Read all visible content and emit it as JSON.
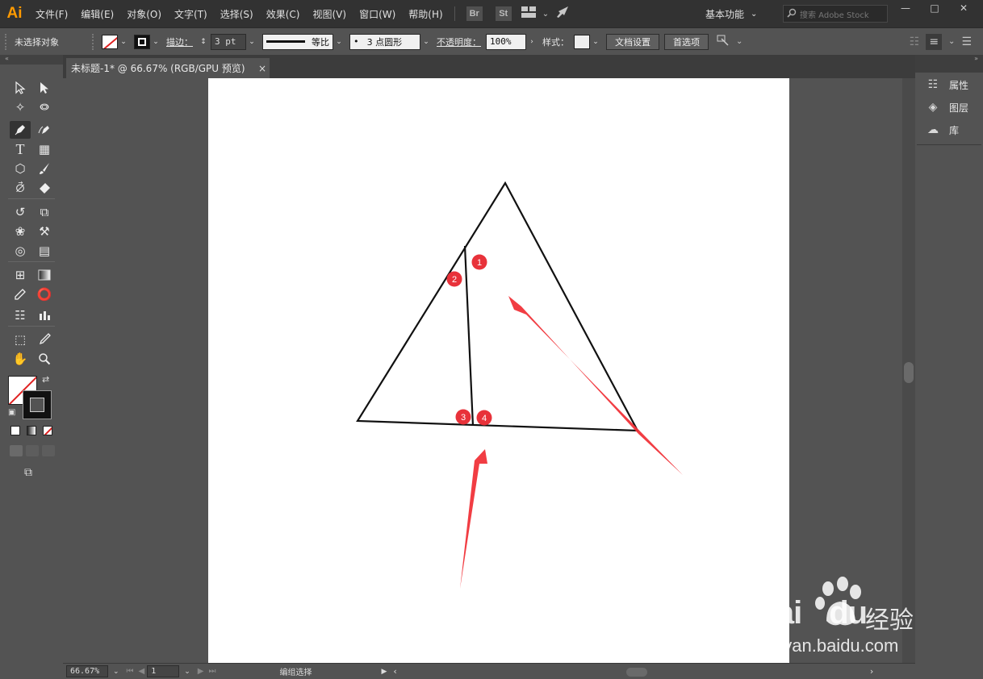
{
  "app": {
    "logo": "Ai"
  },
  "menu": {
    "items": [
      "文件(F)",
      "编辑(E)",
      "对象(O)",
      "文字(T)",
      "选择(S)",
      "效果(C)",
      "视图(V)",
      "窗口(W)",
      "帮助(H)"
    ],
    "bridge_label": "Br",
    "stock_label": "St",
    "workspace": "基本功能",
    "search_placeholder": "搜索 Adobe Stock"
  },
  "control_bar": {
    "selection_status": "未选择对象",
    "stroke_label": "描边：",
    "stroke_weight": "3 pt",
    "stroke_profile": "等比",
    "brush": "3 点圆形",
    "opacity_label": "不透明度：",
    "opacity_value": "100%",
    "style_label": "样式：",
    "doc_setup_button": "文档设置",
    "preferences_button": "首选项"
  },
  "document": {
    "tab_title": "未标题-1* @ 66.67% (RGB/GPU 预览)",
    "close": "×"
  },
  "right_panel": {
    "items": [
      {
        "label": "属性",
        "icon": "properties-icon"
      },
      {
        "label": "图层",
        "icon": "layers-icon"
      },
      {
        "label": "库",
        "icon": "libraries-icon"
      }
    ]
  },
  "status_bar": {
    "zoom": "66.67%",
    "artboard_number": "1",
    "tool_status": "编组选择"
  },
  "annotations": {
    "markers": [
      "1",
      "2",
      "3",
      "4"
    ]
  },
  "watermark": {
    "brand": "Bai",
    "brand_suffix": "du",
    "product": "经验",
    "url": "jingyan.baidu.com"
  },
  "colors": {
    "accent": "#ff9a00",
    "marker": "#e8323a",
    "arrow": "#f03339"
  }
}
